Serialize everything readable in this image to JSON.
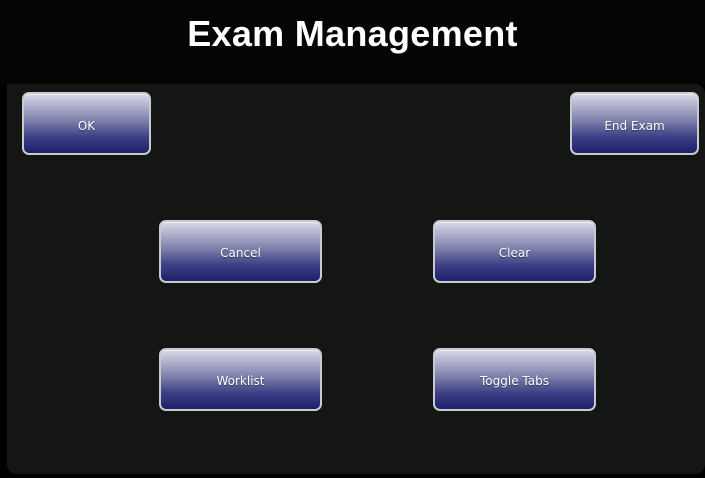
{
  "window": {
    "title": "Exam Management"
  },
  "buttons": {
    "ok": "OK",
    "end_exam": "End Exam",
    "cancel": "Cancel",
    "clear": "Clear",
    "worklist": "Worklist",
    "toggle_tabs": "Toggle Tabs"
  },
  "colors": {
    "background": "#000000",
    "panel": "#141614",
    "button_top": "#d7d8e6",
    "button_bottom": "#1c1f6a",
    "text": "#ffffff"
  }
}
